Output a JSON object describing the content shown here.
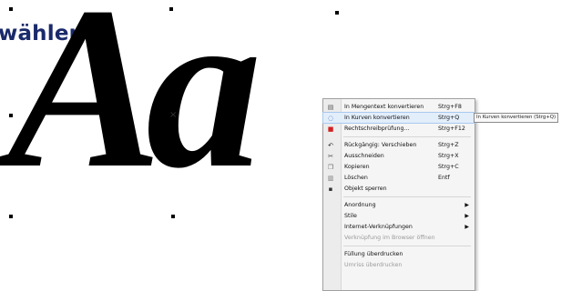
{
  "heading": "wählen",
  "canvas_glyphs": "Aa",
  "menu": {
    "items": [
      {
        "label": "In Mengentext konvertieren",
        "shortcut": "Strg+F8",
        "icon": "text-convert-icon"
      },
      {
        "label": "In Kurven konvertieren",
        "shortcut": "Strg+Q",
        "icon": "curve-convert-icon"
      },
      {
        "label": "Rechtschreibprüfung...",
        "shortcut": "Strg+F12",
        "icon": "spellcheck-icon"
      },
      {
        "label": "Rückgängig: Verschieben",
        "shortcut": "Strg+Z",
        "icon": "undo-icon"
      },
      {
        "label": "Ausschneiden",
        "shortcut": "Strg+X",
        "icon": "scissors-icon"
      },
      {
        "label": "Kopieren",
        "shortcut": "Strg+C",
        "icon": "copy-icon"
      },
      {
        "label": "Löschen",
        "shortcut": "Entf",
        "icon": "trash-icon"
      },
      {
        "label": "Objekt sperren",
        "shortcut": "",
        "icon": "lock-icon"
      },
      {
        "label": "Anordnung",
        "shortcut": "",
        "icon": ""
      },
      {
        "label": "Stile",
        "shortcut": "",
        "icon": ""
      },
      {
        "label": "Internet-Verknüpfungen",
        "shortcut": "",
        "icon": ""
      },
      {
        "label": "Verknüpfung im Browser öffnen",
        "shortcut": "",
        "icon": ""
      },
      {
        "label": "Füllung überdrucken",
        "shortcut": "",
        "icon": ""
      },
      {
        "label": "Umriss überdrucken",
        "shortcut": "",
        "icon": ""
      }
    ],
    "tooltip": "In Kurven konvertieren (Strg+Q)"
  }
}
